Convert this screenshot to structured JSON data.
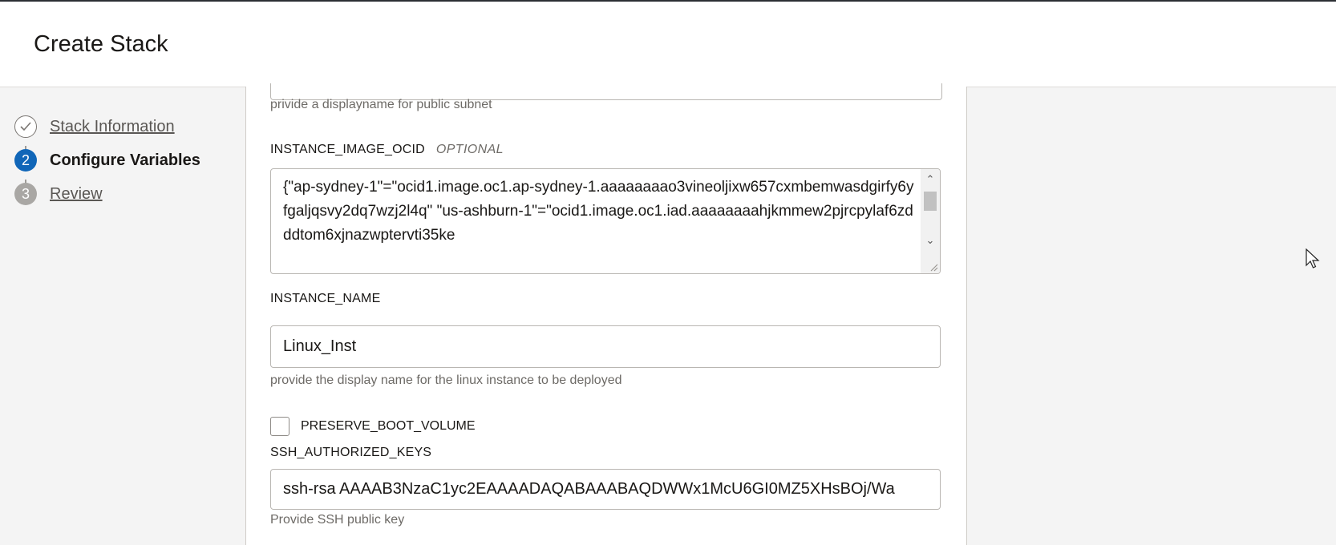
{
  "header": {
    "title": "Create Stack"
  },
  "steps": [
    {
      "number": "",
      "label": "Stack Information",
      "state": "complete"
    },
    {
      "number": "2",
      "label": "Configure Variables",
      "state": "current"
    },
    {
      "number": "3",
      "label": "Review",
      "state": "upcoming"
    }
  ],
  "form": {
    "public_subnet_help": "privide a displayname for public subnet",
    "instance_image_ocid": {
      "label": "INSTANCE_IMAGE_OCID",
      "optional": "OPTIONAL",
      "value": "{\"ap-sydney-1\"=\"ocid1.image.oc1.ap-sydney-1.aaaaaaaao3vineoljixw657cxmbemwasdgirfy6yfgaljqsvy2dq7wzj2l4q\" \"us-ashburn-1\"=\"ocid1.image.oc1.iad.aaaaaaaahjkmmew2pjrcpylaf6zdddtom6xjnazwptervti35ke"
    },
    "instance_name": {
      "label": "INSTANCE_NAME",
      "value": "Linux_Inst",
      "help": "provide the display name for the linux instance to be deployed"
    },
    "preserve_boot_volume": {
      "label": "PRESERVE_BOOT_VOLUME",
      "checked": false
    },
    "ssh_authorized_keys": {
      "label": "SSH_AUTHORIZED_KEYS",
      "value": "ssh-rsa AAAAB3NzaC1yc2EAAAADAQABAAABAQDWWx1McU6GI0MZ5XHsBOj/Wa",
      "help": "Provide SSH public key"
    }
  },
  "colors": {
    "accent": "#1066b8",
    "step_inactive": "#a9a7a4"
  }
}
